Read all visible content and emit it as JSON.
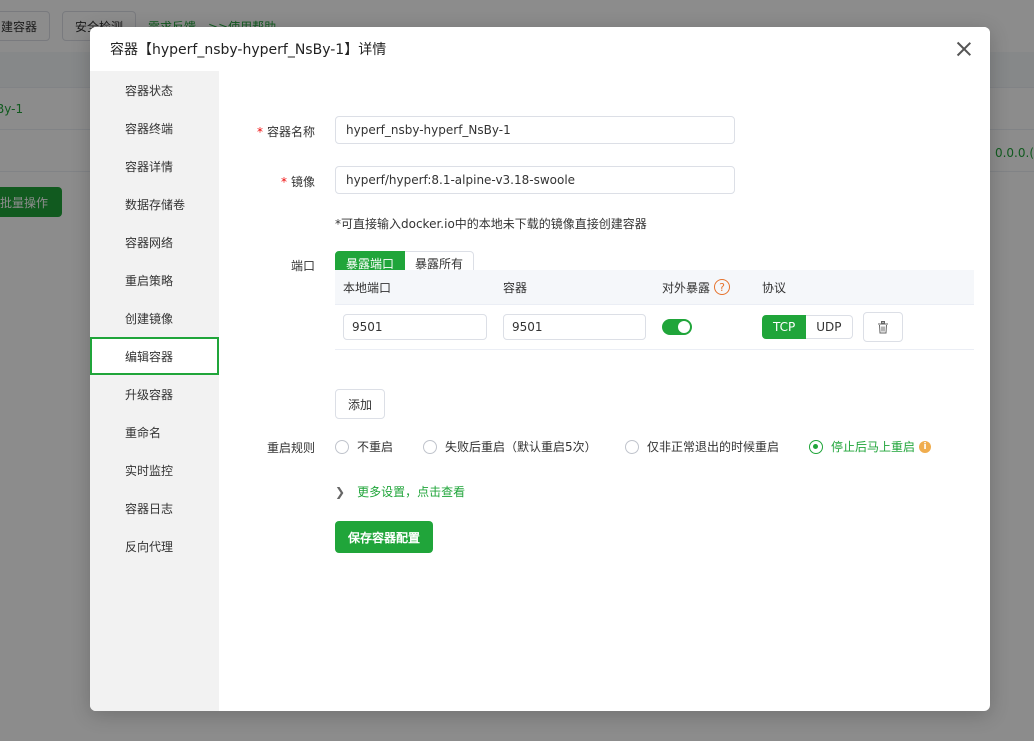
{
  "background": {
    "toolbar": {
      "create_btn": "建容器",
      "security_btn": "安全检测",
      "feedback_link": "需求反馈",
      "help_link": ">>使用帮助"
    },
    "row1_name": "By-1",
    "row2_right": "0.0.0.(",
    "batch_btn": "批量操作"
  },
  "dialog": {
    "title": "容器【hyperf_nsby-hyperf_NsBy-1】详情",
    "sidebar": [
      {
        "label": "容器状态",
        "active": false
      },
      {
        "label": "容器终端",
        "active": false
      },
      {
        "label": "容器详情",
        "active": false
      },
      {
        "label": "数据存储卷",
        "active": false
      },
      {
        "label": "容器网络",
        "active": false
      },
      {
        "label": "重启策略",
        "active": false
      },
      {
        "label": "创建镜像",
        "active": false
      },
      {
        "label": "编辑容器",
        "active": true
      },
      {
        "label": "升级容器",
        "active": false
      },
      {
        "label": "重命名",
        "active": false
      },
      {
        "label": "实时监控",
        "active": false
      },
      {
        "label": "容器日志",
        "active": false
      },
      {
        "label": "反向代理",
        "active": false
      }
    ],
    "form": {
      "name_label": "容器名称",
      "name_value": "hyperf_nsby-hyperf_NsBy-1",
      "image_label": "镜像",
      "image_value": "hyperf/hyperf:8.1-alpine-v3.18-swoole",
      "image_hint": "*可直接输入docker.io中的本地未下载的镜像直接创建容器",
      "port_label": "端口",
      "port_mode": {
        "expose_port": "暴露端口",
        "expose_all": "暴露所有",
        "selected": "暴露端口"
      },
      "port_table": {
        "headers": {
          "local": "本地端口",
          "container": "容器",
          "expose": "对外暴露",
          "protocol": "协议"
        },
        "rows": [
          {
            "local": "9501",
            "container": "9501",
            "expose": true,
            "protocol_tcp": "TCP",
            "protocol_udp": "UDP",
            "selected_protocol": "TCP"
          }
        ]
      },
      "add_btn": "添加",
      "restart_label": "重启规则",
      "restart_options": [
        {
          "label": "不重启",
          "selected": false
        },
        {
          "label": "失败后重启（默认重启5次）",
          "selected": false
        },
        {
          "label": "仅非正常退出的时候重启",
          "selected": false
        },
        {
          "label": "停止后马上重启",
          "selected": true
        }
      ],
      "more_settings": "更多设置，点击查看",
      "save_btn": "保存容器配置"
    }
  },
  "colors": {
    "accent": "#20a53a",
    "required": "#ef0808",
    "warning": "#f0ad4e"
  },
  "icons": {
    "close": "close-icon",
    "help": "question-icon",
    "delete": "trash-icon",
    "info": "info-icon",
    "chevron": "chevron-right-icon"
  }
}
